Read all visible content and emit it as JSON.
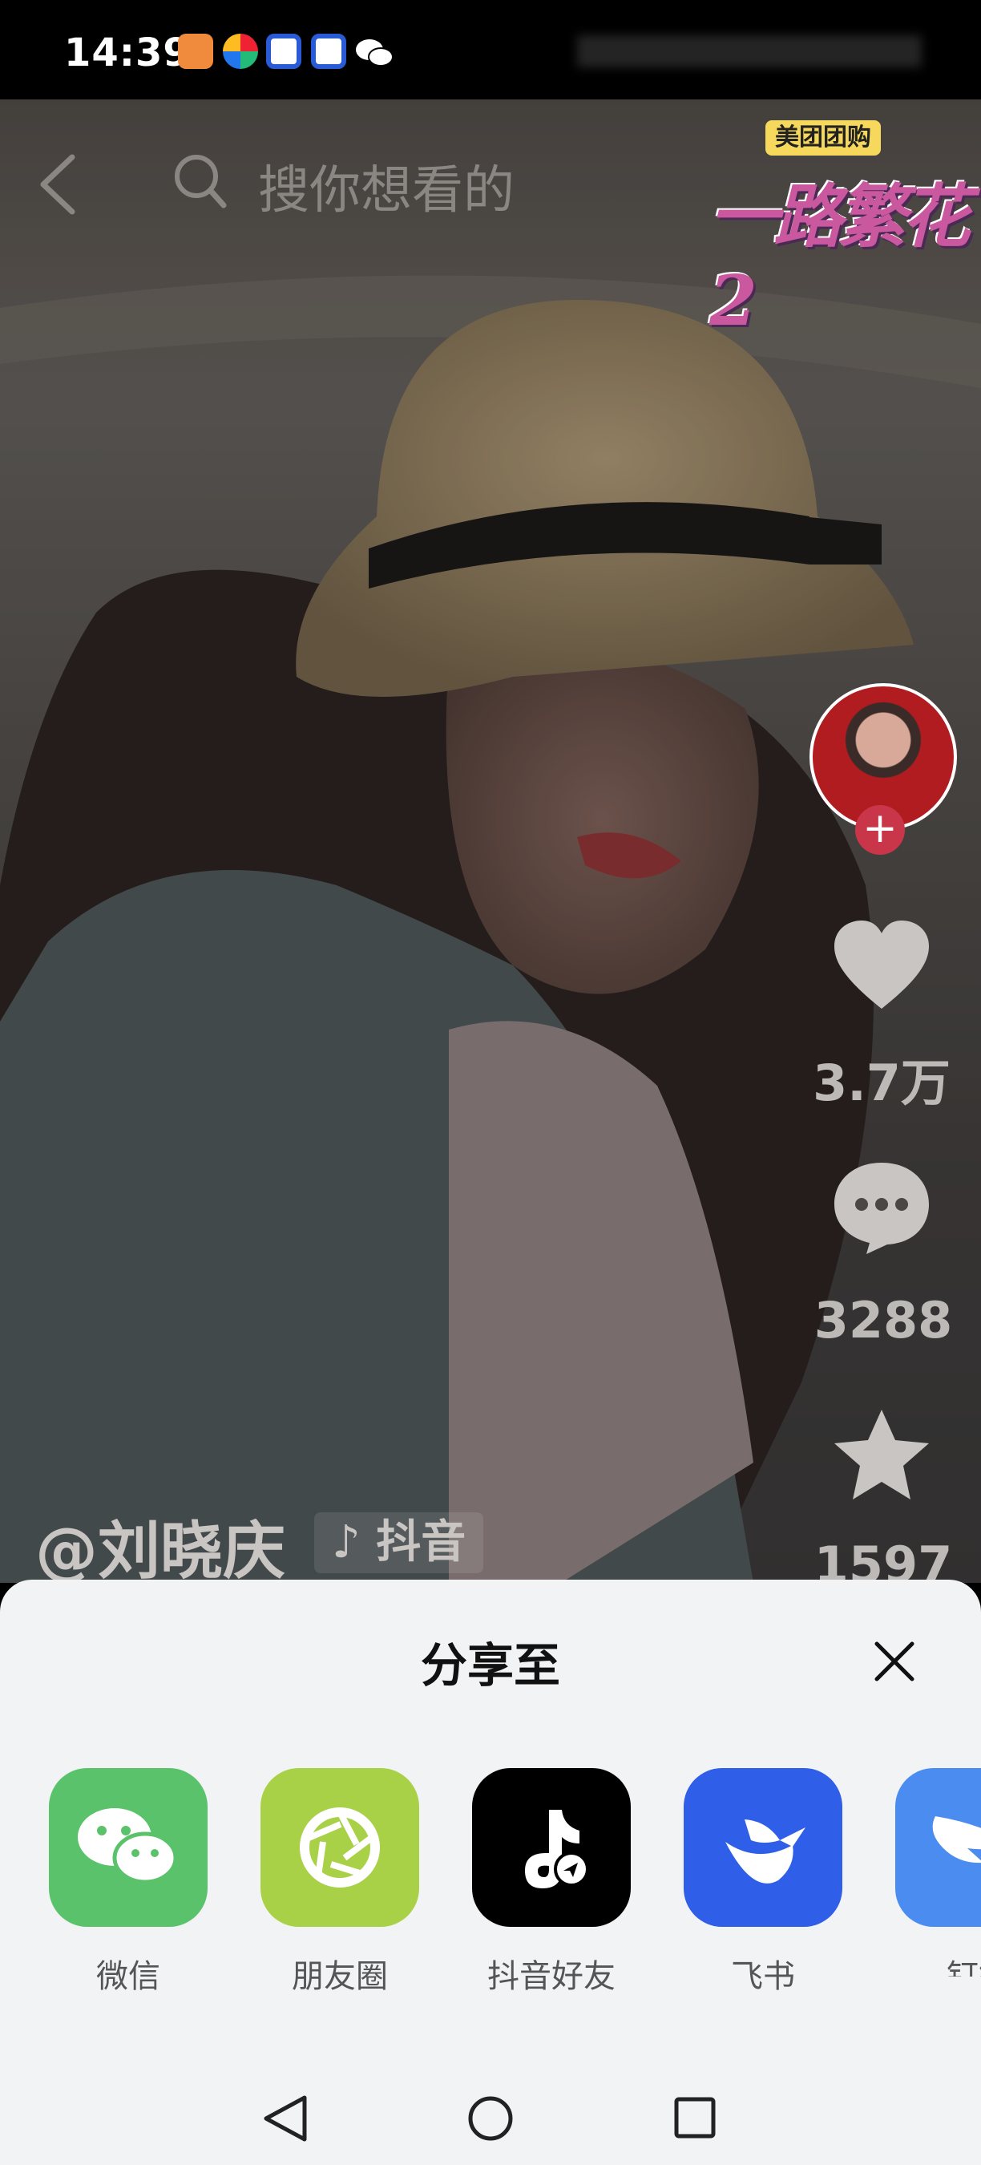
{
  "status_bar": {
    "time": "14:39"
  },
  "search": {
    "placeholder": "搜你想看的"
  },
  "promo": {
    "badge": "美团团购",
    "title": "一路繁花2"
  },
  "rail": {
    "likes": "3.7万",
    "comments": "3288",
    "favorites": "1597"
  },
  "video": {
    "author": "@刘晓庆",
    "platform": "抖音"
  },
  "share_sheet": {
    "title": "分享至",
    "apps": [
      {
        "label": "微信",
        "color": "#5ac26a"
      },
      {
        "label": "朋友圈",
        "color": "#a8d147"
      },
      {
        "label": "抖音好友",
        "color": "#000000"
      },
      {
        "label": "飞书",
        "color": "#2f5ee8"
      },
      {
        "label": "钉钉",
        "color": "#4a8cf0"
      }
    ]
  }
}
